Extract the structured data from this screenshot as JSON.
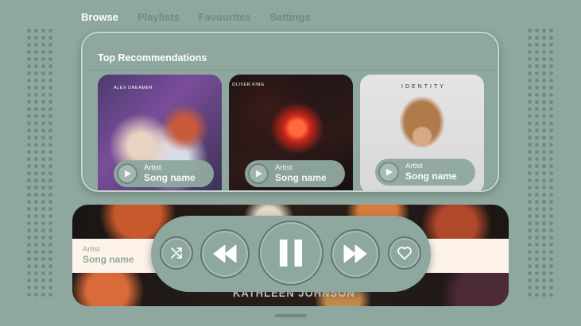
{
  "nav": {
    "tabs": [
      {
        "label": "Browse",
        "active": true
      },
      {
        "label": "Playlists",
        "active": false
      },
      {
        "label": "Favourites",
        "active": false
      },
      {
        "label": "Settings",
        "active": false
      }
    ]
  },
  "recommendations": {
    "title": "Top Recommendations",
    "cards": [
      {
        "art_caption": "ALEX DREAMER",
        "artist": "Artist",
        "song": "Song name",
        "icon": "play-icon"
      },
      {
        "art_caption": "OLIVER KING",
        "artist": "Artist",
        "song": "Song name",
        "icon": "play-icon"
      },
      {
        "art_caption": "IDENTITY",
        "artist": "Artist",
        "song": "Song name",
        "icon": "play-icon"
      }
    ]
  },
  "now_playing": {
    "artist": "Artist",
    "song": "Song name",
    "album_text": "KATHLEEN JOHNSON",
    "controls": [
      "shuffle-icon",
      "rewind-icon",
      "pause-icon",
      "fast-forward-icon",
      "heart-icon"
    ]
  },
  "colors": {
    "background": "#8fa89f",
    "accent_dark": "#6f8a80",
    "text": "#ffffff",
    "band": "#fdf3e9"
  }
}
